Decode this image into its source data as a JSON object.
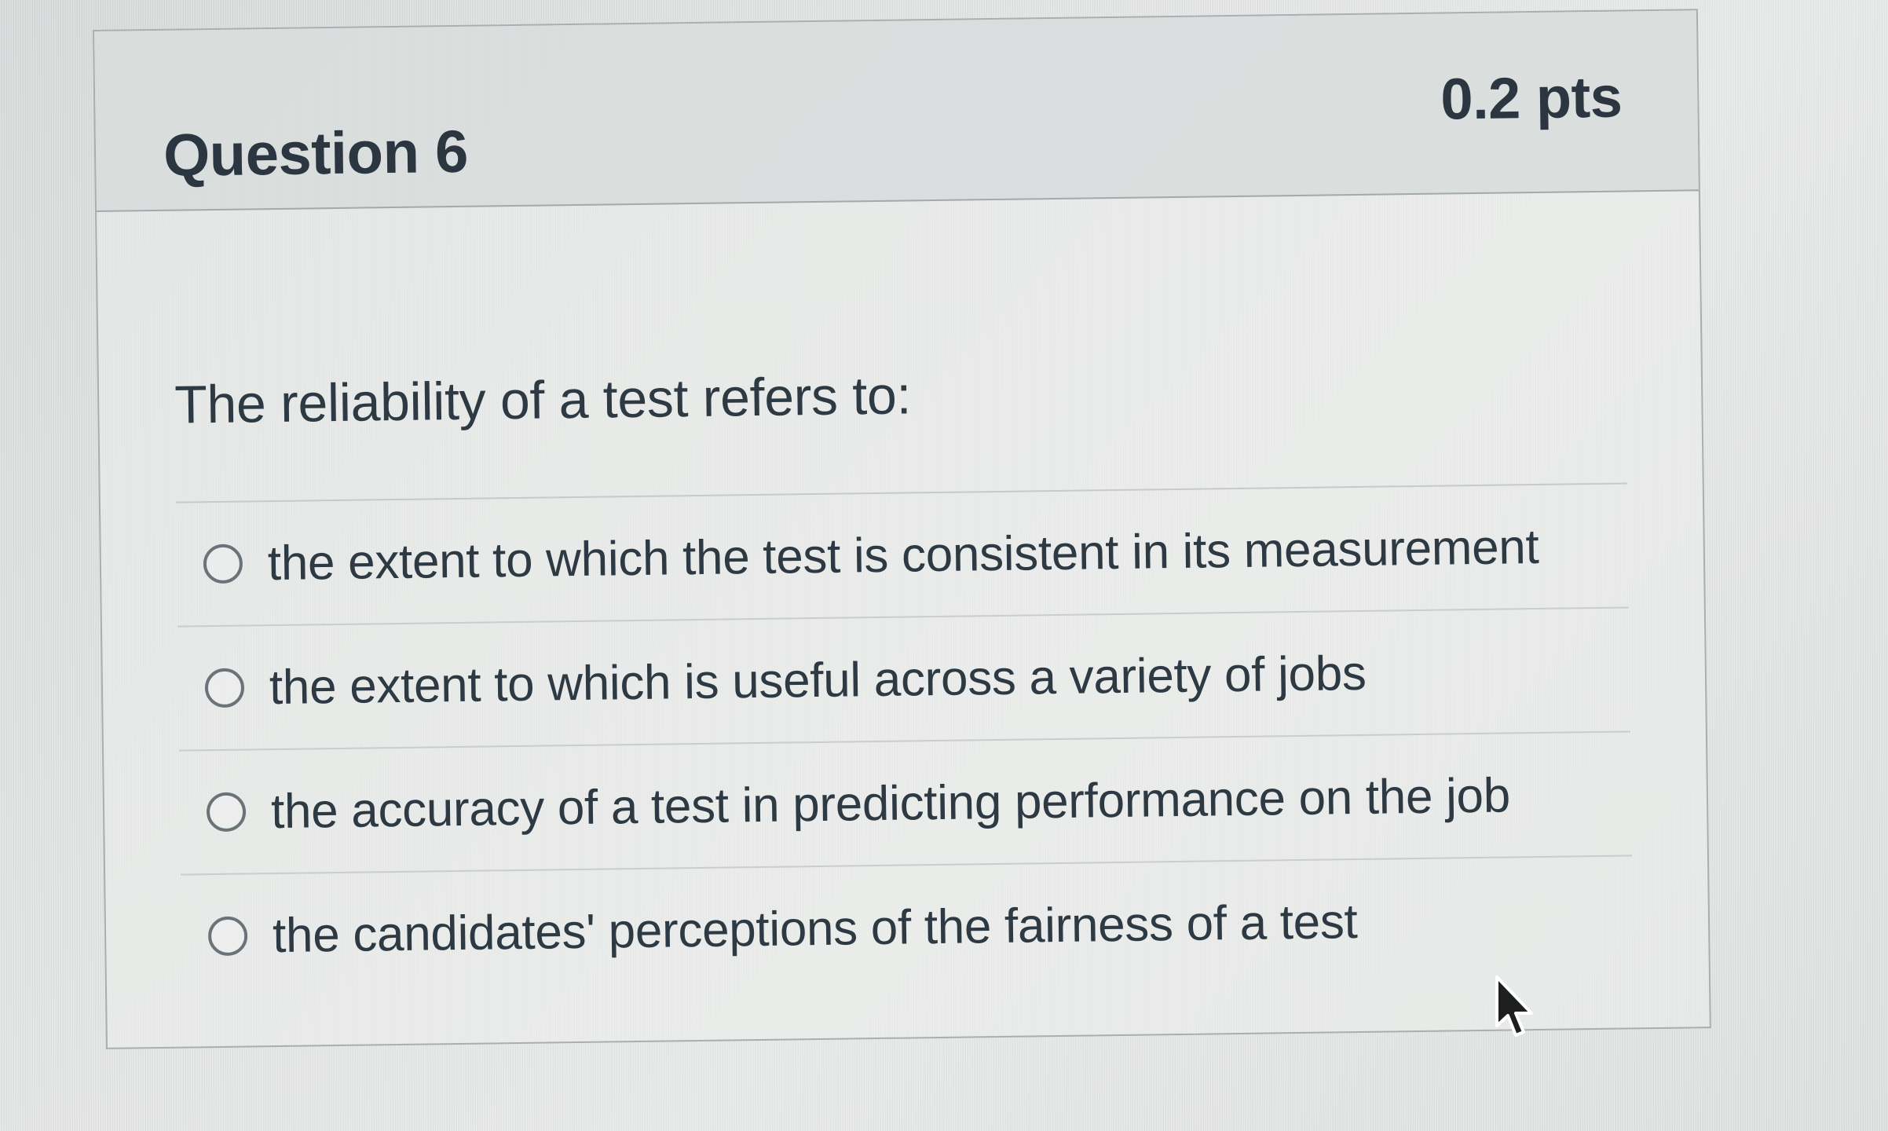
{
  "question": {
    "title": "Question 6",
    "points": "0.2 pts",
    "text": "The reliability of a test refers to:",
    "answers": [
      {
        "label": "the extent to which the test is consistent in its measurement"
      },
      {
        "label": "the extent to which is useful across a variety of jobs"
      },
      {
        "label": "the accuracy of a test in predicting performance on the job"
      },
      {
        "label": "the candidates' perceptions of the fairness of a test"
      }
    ]
  },
  "icons": {
    "radio": "radio-unselected-icon",
    "cursor": "mouse-pointer-icon"
  },
  "colors": {
    "text": "#2d3b45",
    "header_bg": "#d6dada",
    "border": "#a9aeb0"
  }
}
